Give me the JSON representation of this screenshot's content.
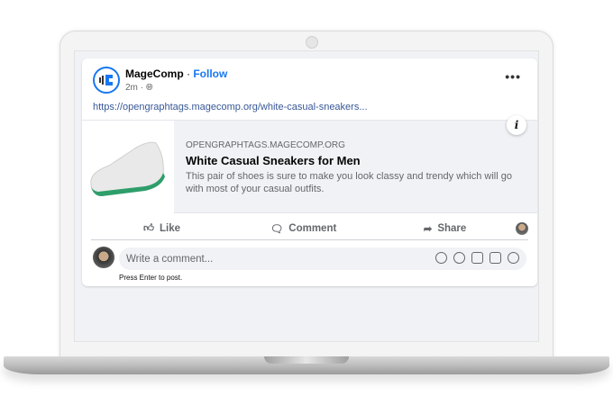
{
  "post": {
    "author": "MageComp",
    "separator": " · ",
    "follow": "Follow",
    "time": "2m ·",
    "privacy_icon": "globe-icon",
    "more_icon": "more-dots-icon",
    "more": "•••",
    "link": "https://opengraphtags.magecomp.org/white-casual-sneakers...",
    "preview": {
      "domain": "OPENGRAPHTAGS.MAGECOMP.ORG",
      "title": "White Casual Sneakers for Men",
      "description": "This pair of shoes is sure to make you look classy and trendy which will go with most of your casual outfits.",
      "info": "i"
    }
  },
  "actions": {
    "like": "Like",
    "comment": "Comment",
    "share": "Share"
  },
  "comment_box": {
    "placeholder": "Write a comment...",
    "hint": "Press Enter to post."
  },
  "colors": {
    "accent": "#1877f2",
    "background": "#f0f2f5"
  }
}
